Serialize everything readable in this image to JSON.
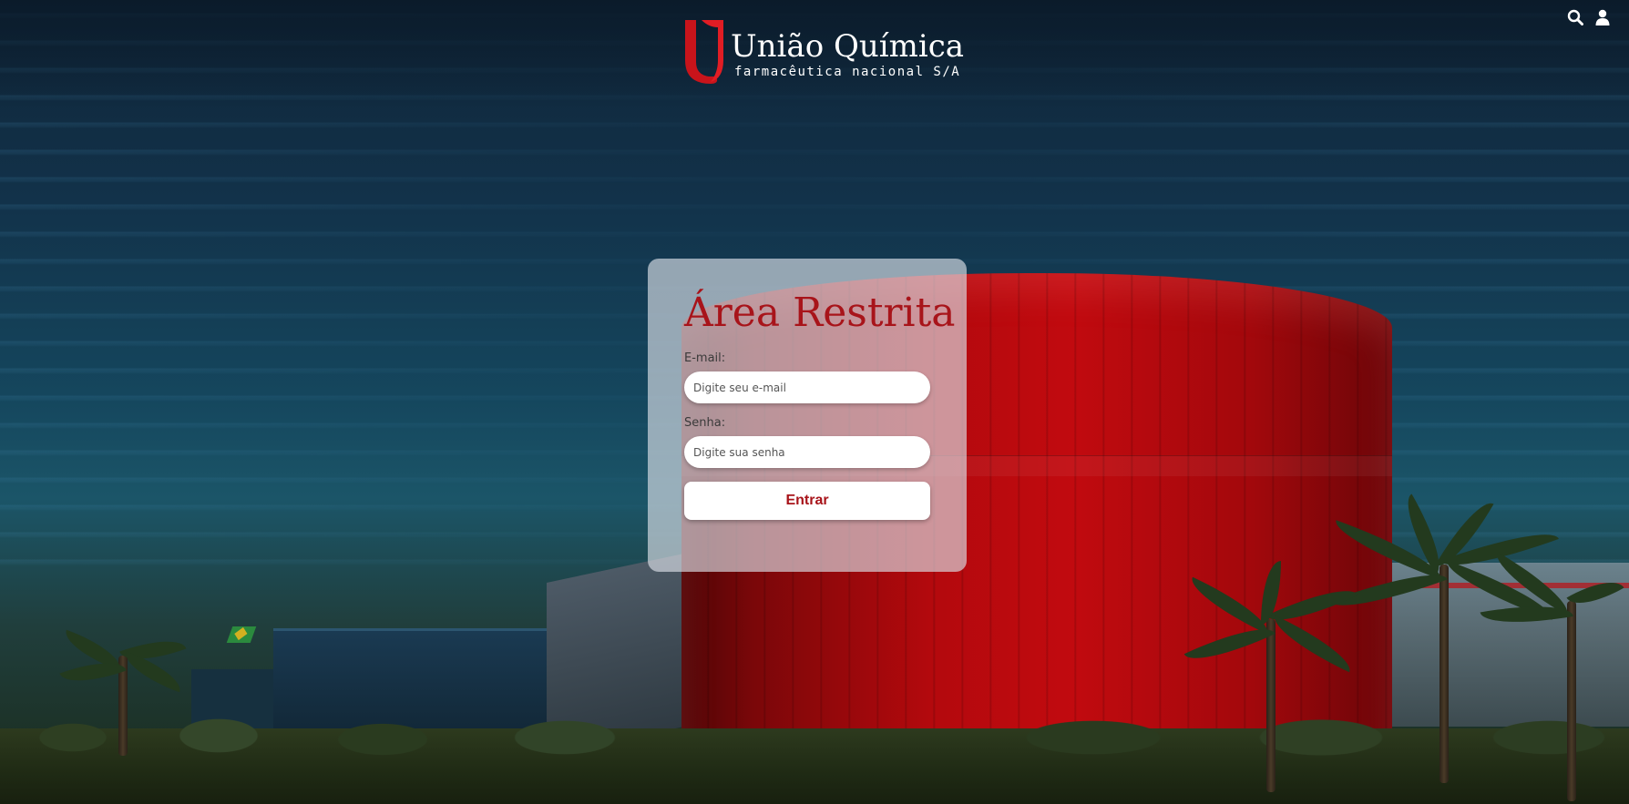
{
  "header": {
    "logo": {
      "name": "União Química",
      "subtitle": "farmacêutica nacional  S/A"
    },
    "icons": [
      "search-icon",
      "user-icon"
    ]
  },
  "login": {
    "title": "Área Restrita",
    "email_label": "E-mail:",
    "email_placeholder": "Digite seu e-mail",
    "password_label": "Senha:",
    "password_placeholder": "Digite sua senha",
    "submit_label": "Entrar"
  },
  "colors": {
    "brand_red": "#a8141a",
    "card_bg": "rgba(220,225,232,0.65)",
    "text_white": "#ffffff"
  }
}
